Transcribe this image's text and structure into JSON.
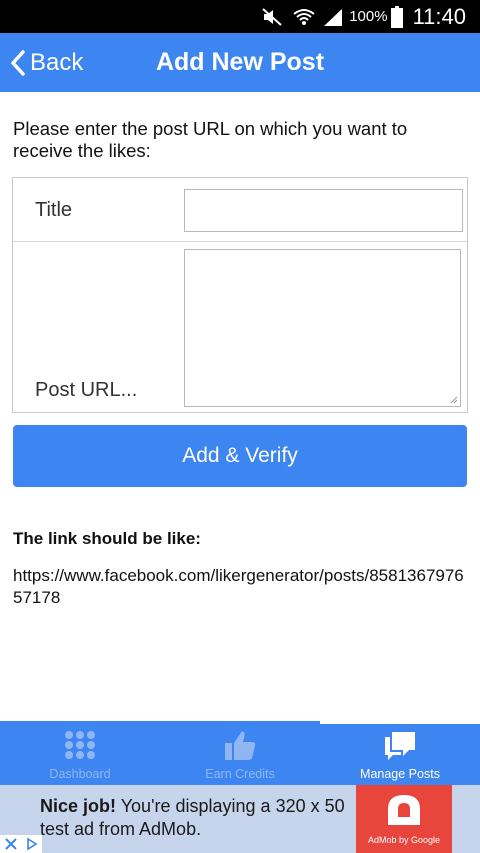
{
  "status_bar": {
    "icons": [
      "mute-icon",
      "wifi-icon",
      "signal-icon",
      "battery-icon"
    ],
    "battery_text": "100%",
    "time": "11:40"
  },
  "action_bar": {
    "back_label": "Back",
    "title": "Add New Post",
    "color": "#3d85f0"
  },
  "form": {
    "instructions": "Please enter the post URL on which you want to receive the likes:",
    "title_label": "Title",
    "title_value": "",
    "url_label": "Post URL...",
    "url_value": "",
    "submit_label": "Add & Verify"
  },
  "example": {
    "heading": "The link should be like:",
    "link": "https://www.facebook.com/likergenerator/posts/858136797657178"
  },
  "tabs": [
    {
      "label": "Dashboard",
      "icon": "grid-dots-icon",
      "active": false
    },
    {
      "label": "Earn Credits",
      "icon": "thumbs-up-icon",
      "active": false
    },
    {
      "label": "Manage Posts",
      "icon": "speech-bubbles-icon",
      "active": true
    }
  ],
  "ad": {
    "headline": "Nice job!",
    "body": " You're displaying a 320 x 50 test ad from AdMob.",
    "caption": "AdMob by Google",
    "accent": "#e8453c"
  }
}
